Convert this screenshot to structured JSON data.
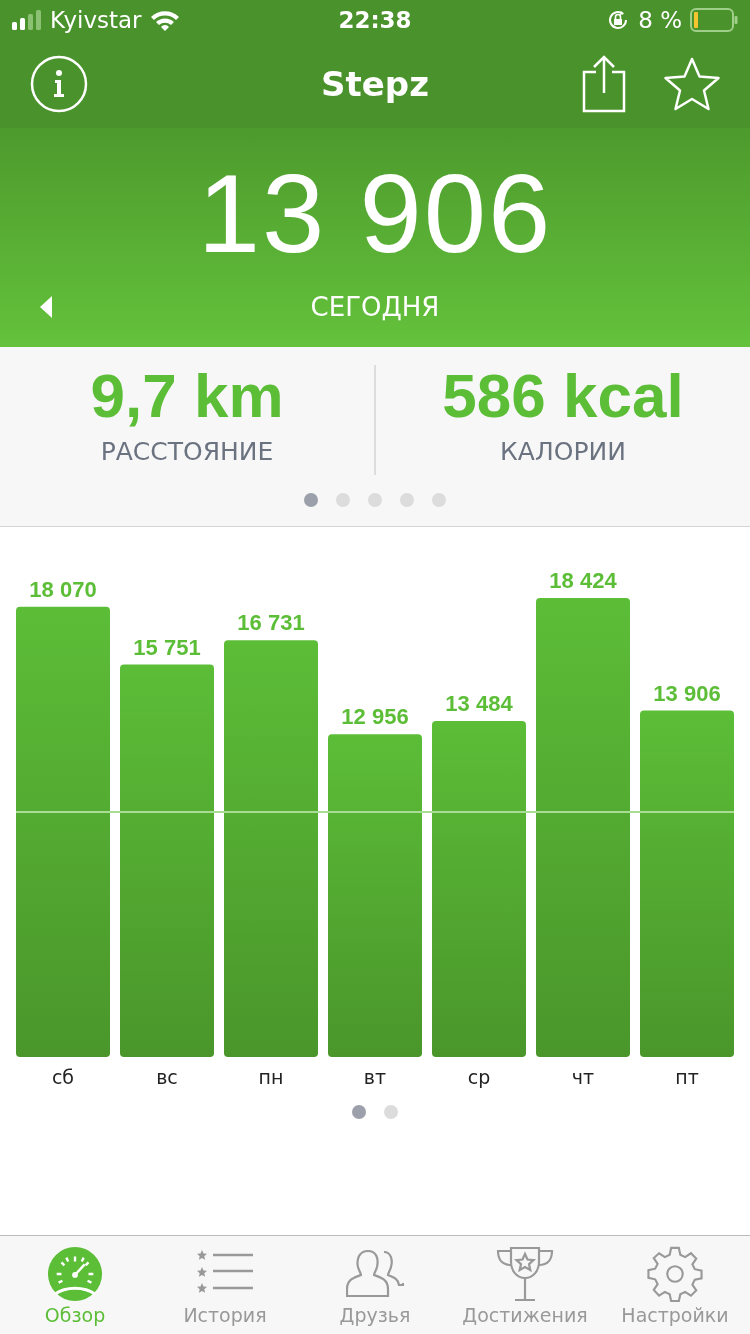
{
  "status_bar": {
    "carrier": "Kyivstar",
    "time": "22:38",
    "battery": "8 %"
  },
  "nav": {
    "title": "Stepz"
  },
  "hero": {
    "steps": "13 906",
    "period": "СЕГОДНЯ"
  },
  "stats": [
    {
      "value": "9,7 km",
      "label": "РАССТОЯНИЕ"
    },
    {
      "value": "586 kcal",
      "label": "КАЛОРИИ"
    }
  ],
  "stats_pager": [
    {
      "selected": true
    },
    {
      "selected": false
    },
    {
      "selected": false
    },
    {
      "selected": false
    },
    {
      "selected": false
    }
  ],
  "chart": {
    "chart_data": {
      "type": "bar",
      "categories": [
        "сб",
        "вс",
        "пн",
        "вт",
        "ср",
        "чт",
        "пт"
      ],
      "series": [
        {
          "color": "#5cbd37",
          "values": [
            18070,
            15751,
            16731,
            12956,
            13484,
            18424,
            13906
          ]
        }
      ],
      "value_labels": [
        "18 070",
        "15 751",
        "16 731",
        "12 956",
        "13 484",
        "18 424",
        "13 906"
      ],
      "data_labels": true,
      "ylim": [
        0,
        18424
      ]
    }
  },
  "chart_pager": [
    {
      "selected": true
    },
    {
      "selected": false
    }
  ],
  "tabs": [
    {
      "label": "Обзор",
      "selected": true
    },
    {
      "label": "История",
      "selected": false
    },
    {
      "label": "Друзья",
      "selected": false
    },
    {
      "label": "Достижения",
      "selected": false
    },
    {
      "label": "Настройки",
      "selected": false
    }
  ]
}
